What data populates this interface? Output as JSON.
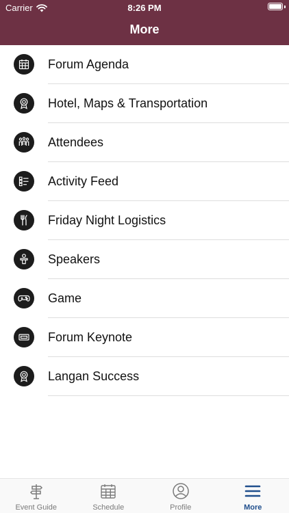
{
  "status_bar": {
    "carrier": "Carrier",
    "time": "8:26 PM"
  },
  "header": {
    "title": "More",
    "background": "#6d3144"
  },
  "menu": {
    "items": [
      {
        "label": "Forum Agenda",
        "icon": "calendar-grid-icon"
      },
      {
        "label": "Hotel, Maps & Transportation",
        "icon": "award-ribbon-icon"
      },
      {
        "label": "Attendees",
        "icon": "people-group-icon"
      },
      {
        "label": "Activity Feed",
        "icon": "list-feed-icon"
      },
      {
        "label": "Friday Night Logistics",
        "icon": "fork-knife-icon"
      },
      {
        "label": "Speakers",
        "icon": "speaker-podium-icon"
      },
      {
        "label": "Game",
        "icon": "gamepad-icon"
      },
      {
        "label": "Forum Keynote",
        "icon": "ticket-card-icon"
      },
      {
        "label": "Langan Success",
        "icon": "award-ribbon-icon"
      }
    ]
  },
  "tab_bar": {
    "active_color": "#1f4e8c",
    "tabs": [
      {
        "label": "Event Guide",
        "icon": "signpost-icon"
      },
      {
        "label": "Schedule",
        "icon": "calendar-icon"
      },
      {
        "label": "Profile",
        "icon": "profile-icon"
      },
      {
        "label": "More",
        "icon": "hamburger-menu-icon",
        "active": true
      }
    ]
  }
}
